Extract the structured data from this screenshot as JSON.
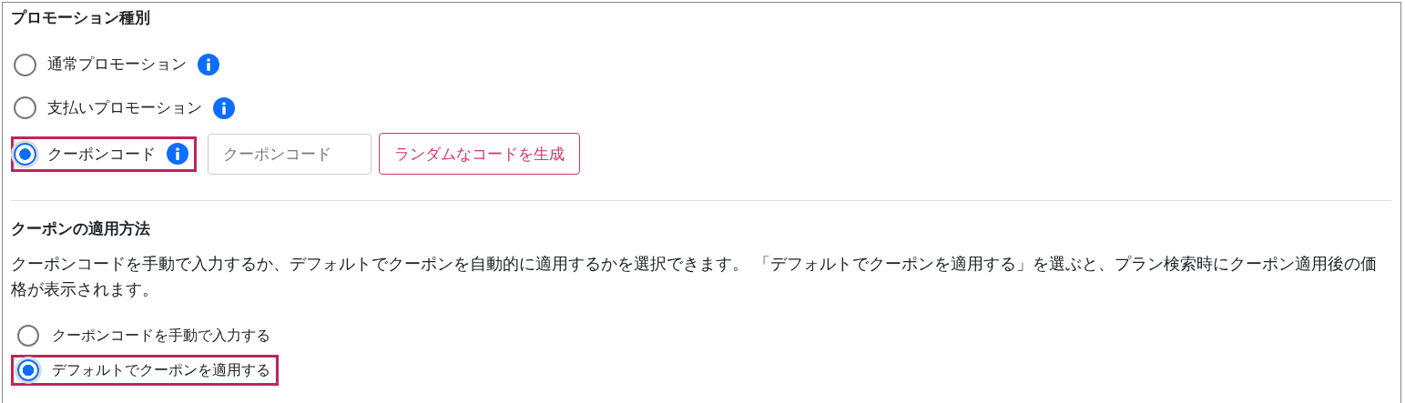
{
  "promotion_type": {
    "title": "プロモーション種別",
    "options": [
      {
        "label": "通常プロモーション",
        "selected": false,
        "highlighted": false
      },
      {
        "label": "支払いプロモーション",
        "selected": false,
        "highlighted": false
      },
      {
        "label": "クーポンコード",
        "selected": true,
        "highlighted": true
      }
    ],
    "coupon_field": {
      "placeholder": "クーポンコード"
    },
    "generate_button": "ランダムなコードを生成"
  },
  "apply_method": {
    "title": "クーポンの適用方法",
    "description": "クーポンコードを手動で入力するか、デフォルトでクーポンを自動的に適用するかを選択できます。 「デフォルトでクーポンを適用する」を選ぶと、プラン検索時にクーポン適用後の価格が表示されます。",
    "options": [
      {
        "label": "クーポンコードを手動で入力する",
        "selected": false,
        "highlighted": false
      },
      {
        "label": "デフォルトでクーポンを適用する",
        "selected": true,
        "highlighted": true
      }
    ]
  }
}
